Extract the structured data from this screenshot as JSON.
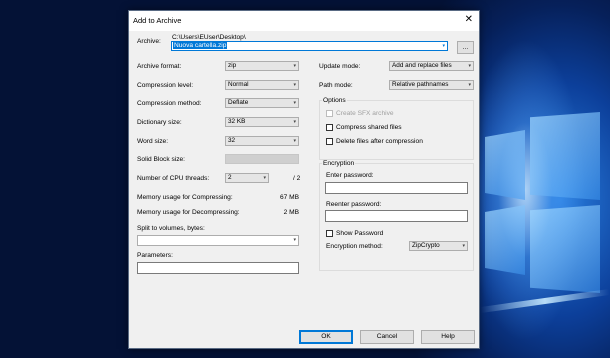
{
  "dialog": {
    "title": "Add to Archive",
    "close_glyph": "✕"
  },
  "archive": {
    "label": "Archive:",
    "path": "C:\\Users\\EUser\\Desktop\\",
    "filename": "Nuova cartella.zip",
    "browse_label": "..."
  },
  "left": {
    "archive_format": {
      "label": "Archive format:",
      "value": "zip"
    },
    "compression_level": {
      "label": "Compression level:",
      "value": "Normal"
    },
    "compression_method": {
      "label": "Compression method:",
      "value": "Deflate"
    },
    "dictionary_size": {
      "label": "Dictionary size:",
      "value": "32 KB"
    },
    "word_size": {
      "label": "Word size:",
      "value": "32"
    },
    "solid_block": {
      "label": "Solid Block size:",
      "value": ""
    },
    "cpu_threads": {
      "label": "Number of CPU threads:",
      "value": "2",
      "max": "/ 2"
    },
    "mem_compress": {
      "label": "Memory usage for Compressing:",
      "value": "67 MB"
    },
    "mem_decompress": {
      "label": "Memory usage for Decompressing:",
      "value": "2 MB"
    },
    "split": {
      "label": "Split to volumes, bytes:",
      "value": ""
    },
    "parameters": {
      "label": "Parameters:",
      "value": ""
    }
  },
  "right": {
    "update_mode": {
      "label": "Update mode:",
      "value": "Add and replace files"
    },
    "path_mode": {
      "label": "Path mode:",
      "value": "Relative pathnames"
    },
    "options": {
      "title": "Options",
      "sfx": "Create SFX archive",
      "shared": "Compress shared files",
      "delete": "Delete files after compression"
    },
    "encryption": {
      "title": "Encryption",
      "enter_password": "Enter password:",
      "reenter_password": "Reenter password:",
      "show_password": "Show Password",
      "method_label": "Encryption method:",
      "method_value": "ZipCrypto"
    }
  },
  "buttons": {
    "ok": "OK",
    "cancel": "Cancel",
    "help": "Help"
  },
  "icons": {
    "dropdown": "▾"
  }
}
